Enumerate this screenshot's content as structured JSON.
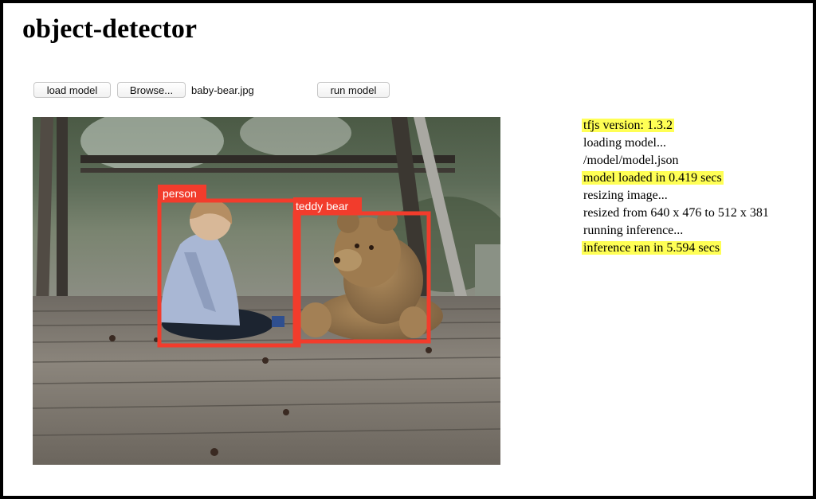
{
  "page": {
    "title": "object-detector"
  },
  "controls": {
    "load_model_label": "load model",
    "browse_label": "Browse...",
    "file_name": "baby-bear.jpg",
    "run_model_label": "run model"
  },
  "detections": [
    {
      "label": "person",
      "color": "#f23c2c"
    },
    {
      "label": "teddy bear",
      "color": "#f23c2c"
    }
  ],
  "log": {
    "highlight_color": "#ffff55",
    "lines": [
      {
        "text": "tfjs version: 1.3.2",
        "highlight": true
      },
      {
        "text": "loading model...",
        "highlight": false
      },
      {
        "text": "/model/model.json",
        "highlight": false
      },
      {
        "text": "model loaded in 0.419 secs",
        "highlight": true
      },
      {
        "text": "resizing image...",
        "highlight": false
      },
      {
        "text": "resized from 640 x 476 to 512 x 381",
        "highlight": false
      },
      {
        "text": "running inference...",
        "highlight": false
      },
      {
        "text": "inference ran in 5.594 secs",
        "highlight": true
      }
    ]
  }
}
